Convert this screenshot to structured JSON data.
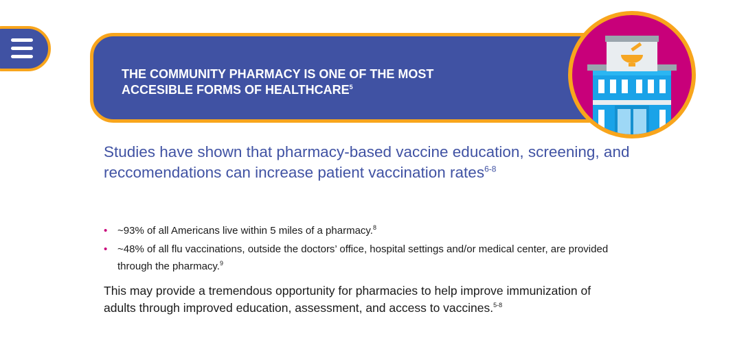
{
  "banner": {
    "title": "THE COMMUNITY PHARMACY IS ONE OF THE MOST ACCESIBLE FORMS OF HEALTHCARE",
    "title_ref": "5"
  },
  "headline": {
    "text": "Studies have shown that pharmacy-based vaccine education, screening, and reccomendations can increase patient vaccination rates",
    "ref": "6-8"
  },
  "bullets": [
    {
      "marker": "•",
      "text": "~93% of all Americans live within 5 miles of a pharmacy.",
      "ref": "8"
    },
    {
      "marker": "•",
      "text": "~48% of all flu vaccinations, outside the doctors’ office, hospital settings and/or medical center, are provided through the pharmacy.",
      "ref": "9"
    }
  ],
  "body": {
    "text": "This may provide a tremendous opportunity for pharmacies to help improve immunization of adults through improved education, assessment, and access to vaccines.",
    "ref": "5-8"
  },
  "icons": {
    "menu": "hamburger-menu-icon",
    "pharmacy": "pharmacy-building-icon"
  },
  "colors": {
    "brand_blue": "#4052a3",
    "accent_orange": "#f8a51c",
    "magenta": "#c8007a",
    "building_blue": "#1aa3e8"
  }
}
